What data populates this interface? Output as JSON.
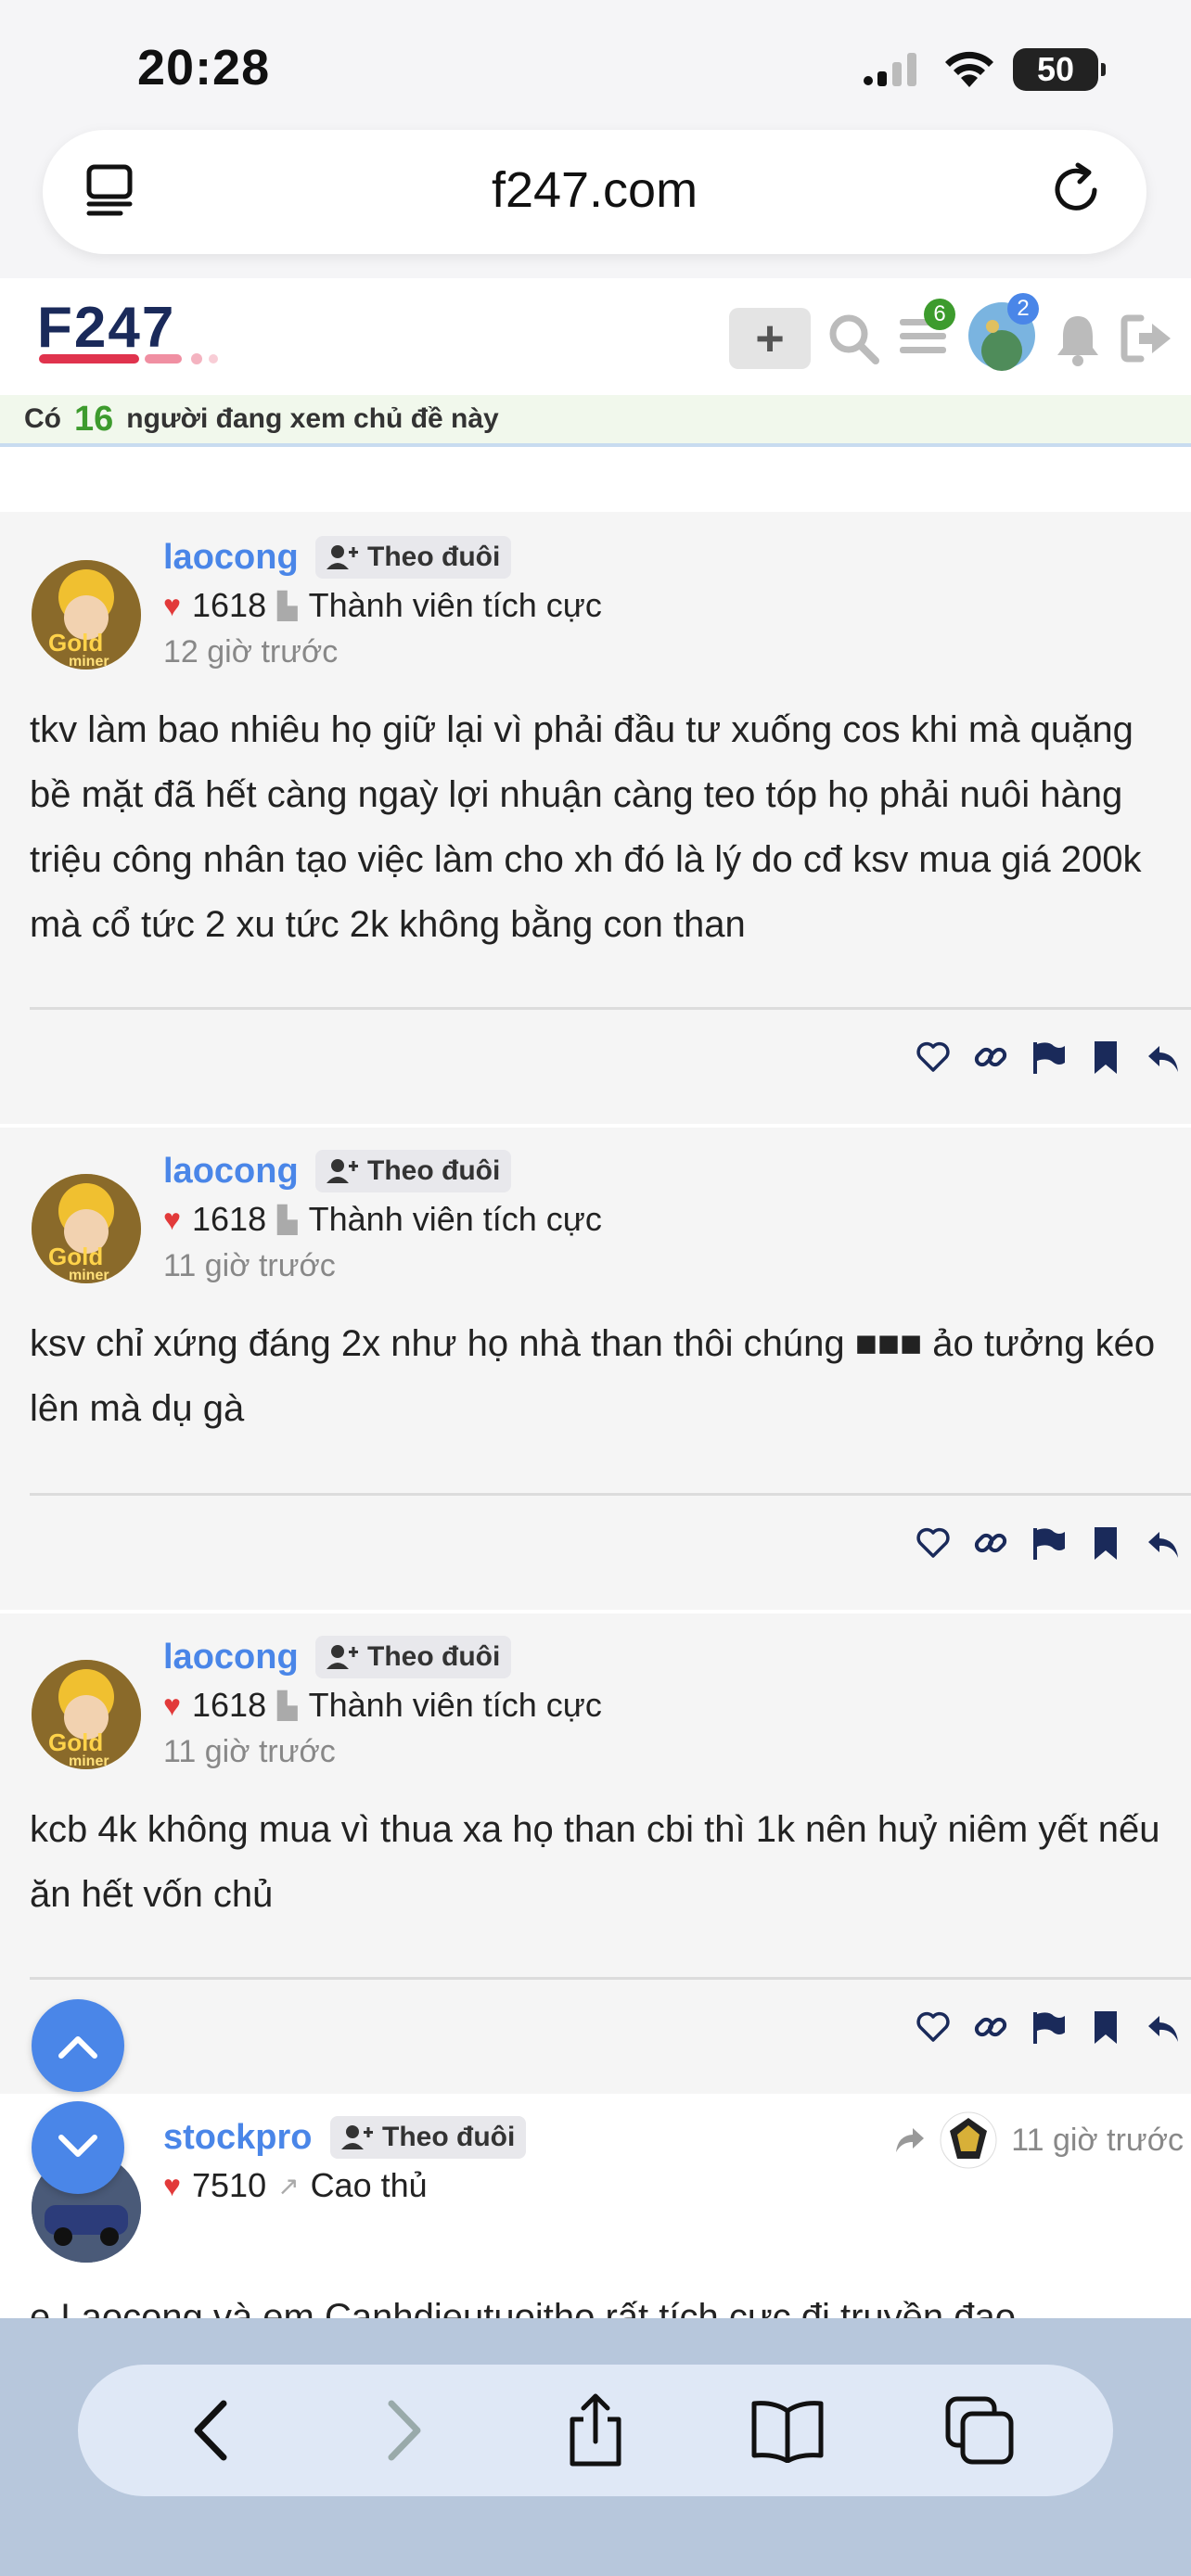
{
  "status_bar": {
    "time": "20:28",
    "battery": "50"
  },
  "browser": {
    "url": "f247.com"
  },
  "site": {
    "logo_text": "F247",
    "header_badge_a": "6",
    "header_badge_b": "2"
  },
  "viewers_bar": {
    "prefix": "Có",
    "count": "16",
    "suffix": "người đang xem chủ đề này"
  },
  "posts": [
    {
      "username": "laocong",
      "follow_label": "Theo đuôi",
      "likes": "1618",
      "rank": "Thành viên tích cực",
      "time": "12 giờ trước",
      "body": "tkv làm bao nhiêu họ giữ lại vì phải đầu tư xuống cos khi mà quặng bề mặt đã hết càng ngaỳ lợi nhuận càng teo tóp họ phải nuôi hàng triệu công nhân tạo việc làm cho xh đó là lý do cđ ksv mua giá 200k mà cổ tức 2 xu tức 2k không bằng con than"
    },
    {
      "username": "laocong",
      "follow_label": "Theo đuôi",
      "likes": "1618",
      "rank": "Thành viên tích cực",
      "time": "11 giờ trước",
      "body": "ksv chỉ xứng đáng 2x như họ nhà than thôi chúng ■■■ ảo tưởng kéo lên mà dụ gà"
    },
    {
      "username": "laocong",
      "follow_label": "Theo đuôi",
      "likes": "1618",
      "rank": "Thành viên tích cực",
      "time": "11 giờ trước",
      "body": "kcb 4k không mua vì thua xa họ than cbi thì 1k nên huỷ niêm yết nếu ăn hết vốn chủ"
    },
    {
      "username": "stockpro",
      "follow_label": "Theo đuôi",
      "likes": "7510",
      "rank": "Cao thủ",
      "time": "11 giờ trước",
      "body": "e Laocong và em Canhdieutuoitho rất tích cực đi truyền đạo"
    }
  ],
  "colors": {
    "accent": "#4a86e8",
    "heart": "#e23a3a",
    "navy": "#1a2a5a",
    "green": "#3d9b2d"
  }
}
